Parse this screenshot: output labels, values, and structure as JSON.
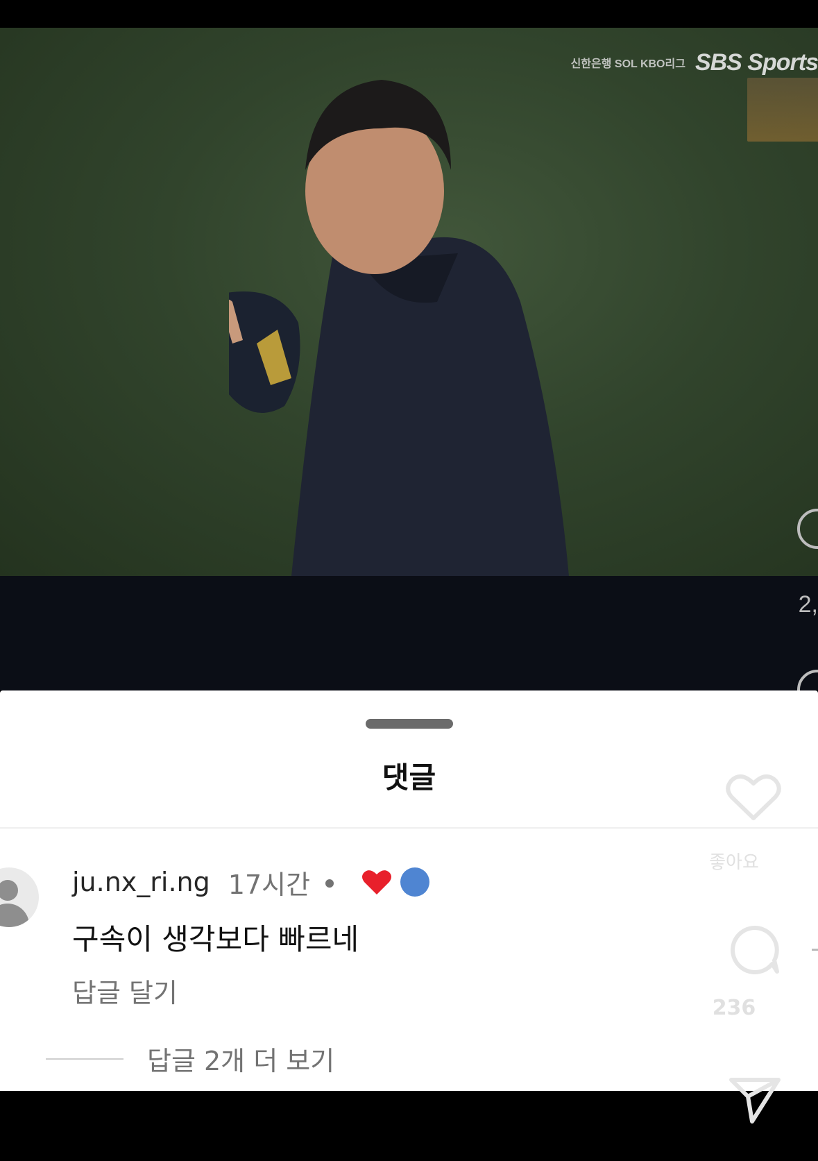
{
  "video": {
    "bank_logo": "신한은행 SOL KBO리그",
    "broadcaster_logo": "SBS Sports",
    "side_count": "2,"
  },
  "comments_sheet": {
    "title": "댓글",
    "comment": {
      "username": "ju.nx_ri.ng",
      "time": "17시간",
      "text": "구속이 생각보다 빠르네",
      "reply_label": "답글 달기",
      "view_more_replies": "답글 2개 더 보기"
    }
  },
  "right_rail": {
    "like_label": "좋아요",
    "comment_count": "236"
  },
  "colors": {
    "heart_red": "#e8202b",
    "blue_circle": "#4f85d2",
    "sheet_bg": "#ffffff"
  }
}
